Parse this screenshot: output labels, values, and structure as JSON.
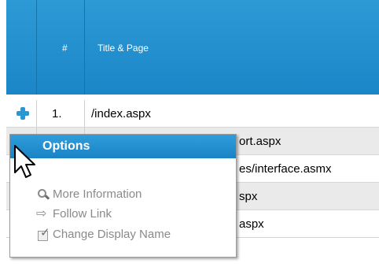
{
  "table": {
    "columns": [
      "#",
      "Title & Page"
    ],
    "rows": [
      {
        "num": "1.",
        "page": "/index.aspx"
      },
      {
        "num": "",
        "page": "ort.aspx"
      },
      {
        "num": "",
        "page": "es/interface.asmx"
      },
      {
        "num": "",
        "page": "spx"
      },
      {
        "num": "",
        "page": "aspx"
      }
    ]
  },
  "popup": {
    "title": "Options",
    "items": [
      {
        "label": "More Information",
        "icon": "magnifier-icon"
      },
      {
        "label": "Follow Link",
        "icon": "arrow-right-icon"
      },
      {
        "label": "Change Display Name",
        "icon": "edit-checkbox-icon"
      }
    ]
  },
  "colors": {
    "header": "#1f8fd0",
    "alt_row": "#eaeaea",
    "menu_text": "#8a8a8a"
  }
}
